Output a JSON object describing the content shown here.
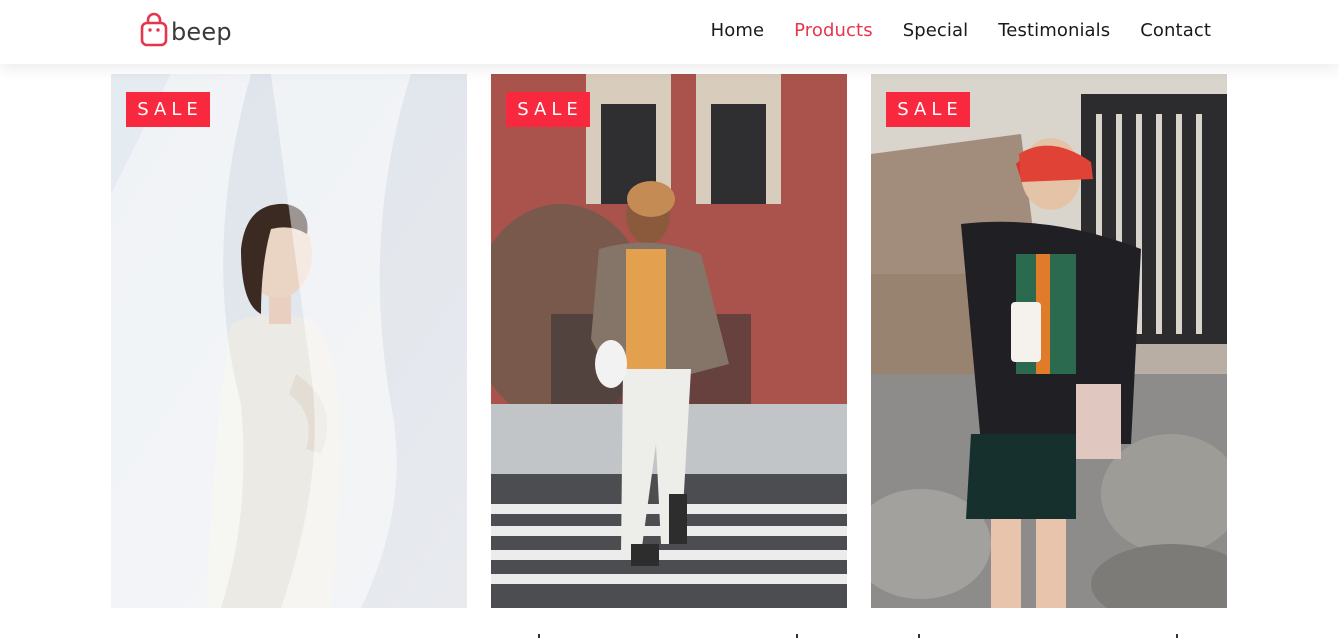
{
  "header": {
    "logo_text": "beep",
    "nav": [
      {
        "label": "Home",
        "active": false
      },
      {
        "label": "Products",
        "active": true
      },
      {
        "label": "Special",
        "active": false
      },
      {
        "label": "Testimonials",
        "active": false
      },
      {
        "label": "Contact",
        "active": false
      }
    ]
  },
  "colors": {
    "accent": "#e8354e",
    "badge": "#f8283f"
  },
  "products": [
    {
      "badge": "SALE"
    },
    {
      "badge": "SALE"
    },
    {
      "badge": "SALE"
    }
  ]
}
